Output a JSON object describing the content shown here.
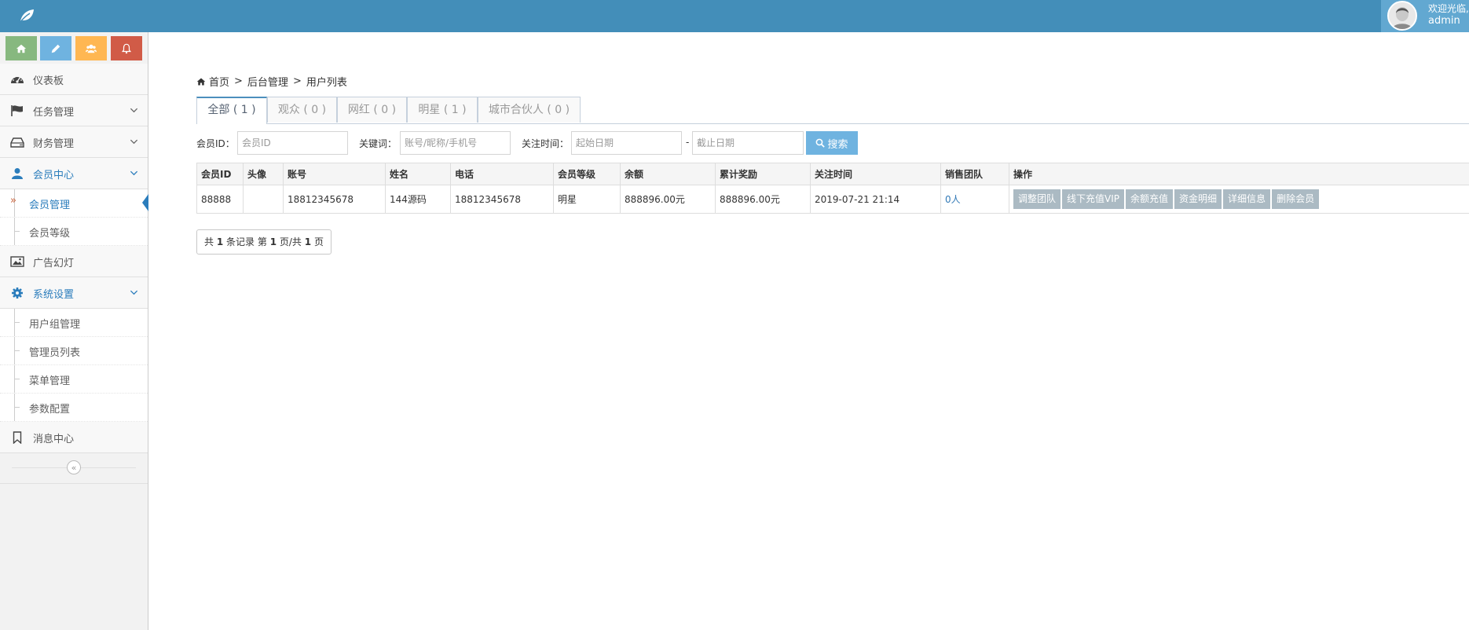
{
  "header": {
    "welcome": "欢迎光临,",
    "username": "admin"
  },
  "colors": {
    "topbar": "#438eb9",
    "shortcut_home": "#87b87f",
    "shortcut_edit": "#6fb3e0",
    "shortcut_users": "#ffb752",
    "shortcut_bell": "#d15b47",
    "accent": "#2b7dbc",
    "op_button": "#abbac3"
  },
  "sidebar": {
    "shortcuts": [
      {
        "icon": "home-icon"
      },
      {
        "icon": "pencil-icon"
      },
      {
        "icon": "users-icon"
      },
      {
        "icon": "bell-icon"
      }
    ],
    "items": [
      {
        "label": "仪表板",
        "icon": "dashboard-icon"
      },
      {
        "label": "任务管理",
        "icon": "flag-icon"
      },
      {
        "label": "财务管理",
        "icon": "hdd-icon"
      },
      {
        "label": "会员中心",
        "icon": "user-icon",
        "children": [
          "会员管理",
          "会员等级"
        ]
      },
      {
        "label": "广告幻灯",
        "icon": "picture-icon"
      },
      {
        "label": "系统设置",
        "icon": "cog-icon",
        "children": [
          "用户组管理",
          "管理员列表",
          "菜单管理",
          "参数配置"
        ]
      },
      {
        "label": "消息中心",
        "icon": "bookmark-icon"
      }
    ],
    "sub_marker": "»",
    "collapse_glyph": "«"
  },
  "breadcrumb": {
    "home": "首页",
    "sep": ">",
    "level2": "后台管理",
    "level3": "用户列表"
  },
  "tabs": [
    {
      "label": "全部 ( 1 )"
    },
    {
      "label": "观众 ( 0 )"
    },
    {
      "label": "网红 ( 0 )"
    },
    {
      "label": "明星 ( 1 )"
    },
    {
      "label": "城市合伙人 ( 0 )"
    }
  ],
  "filters": {
    "member_id_label": "会员ID：",
    "member_id_placeholder": "会员ID",
    "keyword_label": "关键词：",
    "keyword_placeholder": "账号/昵称/手机号",
    "time_label": "关注时间：",
    "start_placeholder": "起始日期",
    "dash": "-",
    "end_placeholder": "截止日期",
    "search_label": "搜索"
  },
  "table": {
    "columns": [
      "会员ID",
      "头像",
      "账号",
      "姓名",
      "电话",
      "会员等级",
      "余额",
      "累计奖励",
      "关注时间",
      "销售团队",
      "操作"
    ],
    "rows": [
      {
        "id": "88888",
        "avatar": "",
        "account": "18812345678",
        "name": "144源码",
        "phone": "18812345678",
        "level": "明星",
        "balance": "888896.00元",
        "reward": "888896.00元",
        "follow_time": "2019-07-21 21:14",
        "team": "0人",
        "actions": [
          "调整团队",
          "线下充值VIP",
          "余额充值",
          "资金明细",
          "详细信息",
          "删除会员"
        ]
      }
    ]
  },
  "pager": {
    "p1": "共",
    "total": "1",
    "p2": "条记录 第",
    "page": "1",
    "p3": "页/共",
    "pages": "1",
    "p4": "页"
  }
}
